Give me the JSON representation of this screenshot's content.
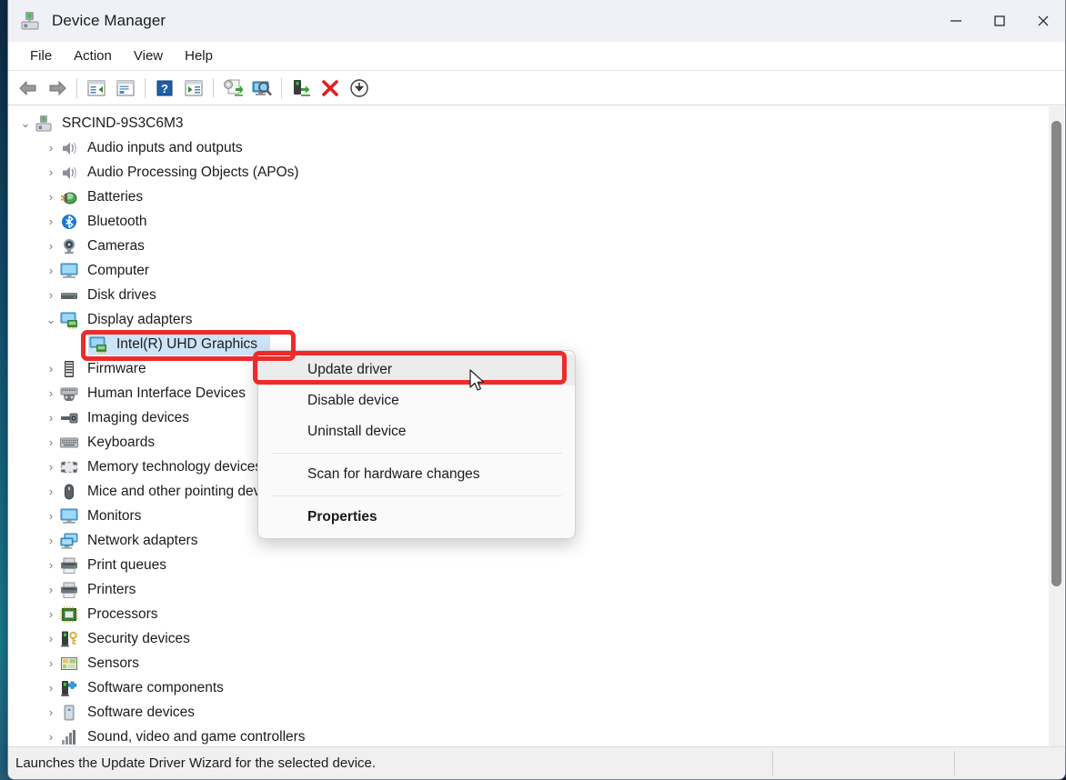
{
  "window": {
    "title": "Device Manager",
    "icon": "device-manager-icon",
    "controls": {
      "minimize": "—",
      "maximize": "☐",
      "close": "✕"
    }
  },
  "menubar": {
    "items": [
      {
        "label": "File",
        "name": "menu-file"
      },
      {
        "label": "Action",
        "name": "menu-action"
      },
      {
        "label": "View",
        "name": "menu-view"
      },
      {
        "label": "Help",
        "name": "menu-help"
      }
    ]
  },
  "toolbar": {
    "buttons": [
      {
        "name": "back-icon",
        "glyph": "back-arrow"
      },
      {
        "name": "forward-icon",
        "glyph": "forward-arrow"
      },
      {
        "name": "separator",
        "glyph": "sep"
      },
      {
        "name": "show-hide-console-tree-icon",
        "glyph": "window-tree"
      },
      {
        "name": "properties-window-icon",
        "glyph": "window-props"
      },
      {
        "name": "separator",
        "glyph": "sep"
      },
      {
        "name": "help-icon",
        "glyph": "help-question"
      },
      {
        "name": "show-hide-action-pane-icon",
        "glyph": "window-play"
      },
      {
        "name": "separator",
        "glyph": "sep"
      },
      {
        "name": "update-driver-icon",
        "glyph": "gear-update"
      },
      {
        "name": "scan-for-hardware-changes-icon",
        "glyph": "monitor-scan"
      },
      {
        "name": "separator",
        "glyph": "sep"
      },
      {
        "name": "enable-device-icon",
        "glyph": "device-enable"
      },
      {
        "name": "uninstall-device-icon",
        "glyph": "red-x"
      },
      {
        "name": "download-icon",
        "glyph": "circle-down-arrow"
      }
    ]
  },
  "tree": {
    "root": {
      "label": "SRCIND-9S3C6M3",
      "icon": "computer-device-icon",
      "expanded": true,
      "chevron": "⌄"
    },
    "items": [
      {
        "label": "Audio inputs and outputs",
        "icon": "speaker-icon",
        "level": 1,
        "expanded": false
      },
      {
        "label": "Audio Processing Objects (APOs)",
        "icon": "speaker-icon",
        "level": 1,
        "expanded": false
      },
      {
        "label": "Batteries",
        "icon": "battery-icon",
        "level": 1,
        "expanded": false
      },
      {
        "label": "Bluetooth",
        "icon": "bluetooth-icon",
        "level": 1,
        "expanded": false
      },
      {
        "label": "Cameras",
        "icon": "camera-icon",
        "level": 1,
        "expanded": false
      },
      {
        "label": "Computer",
        "icon": "monitor-icon",
        "level": 1,
        "expanded": false
      },
      {
        "label": "Disk drives",
        "icon": "disk-drive-icon",
        "level": 1,
        "expanded": false
      },
      {
        "label": "Display adapters",
        "icon": "display-adapter-icon",
        "level": 1,
        "expanded": true
      },
      {
        "label": "Intel(R) UHD Graphics",
        "icon": "display-adapter-icon",
        "level": 2,
        "selected": true
      },
      {
        "label": "Firmware",
        "icon": "firmware-icon",
        "level": 1,
        "expanded": false
      },
      {
        "label": "Human Interface Devices",
        "icon": "hid-icon",
        "level": 1,
        "expanded": false
      },
      {
        "label": "Imaging devices",
        "icon": "imaging-icon",
        "level": 1,
        "expanded": false
      },
      {
        "label": "Keyboards",
        "icon": "keyboard-icon",
        "level": 1,
        "expanded": false
      },
      {
        "label": "Memory technology devices",
        "icon": "memory-icon",
        "level": 1,
        "expanded": false
      },
      {
        "label": "Mice and other pointing devices",
        "icon": "mouse-icon",
        "level": 1,
        "expanded": false
      },
      {
        "label": "Monitors",
        "icon": "monitor-icon",
        "level": 1,
        "expanded": false
      },
      {
        "label": "Network adapters",
        "icon": "network-adapter-icon",
        "level": 1,
        "expanded": false
      },
      {
        "label": "Print queues",
        "icon": "printer-icon",
        "level": 1,
        "expanded": false
      },
      {
        "label": "Printers",
        "icon": "printer-icon",
        "level": 1,
        "expanded": false
      },
      {
        "label": "Processors",
        "icon": "processor-icon",
        "level": 1,
        "expanded": false
      },
      {
        "label": "Security devices",
        "icon": "security-device-icon",
        "level": 1,
        "expanded": false
      },
      {
        "label": "Sensors",
        "icon": "sensor-icon",
        "level": 1,
        "expanded": false
      },
      {
        "label": "Software components",
        "icon": "software-component-icon",
        "level": 1,
        "expanded": false
      },
      {
        "label": "Software devices",
        "icon": "software-device-icon",
        "level": 1,
        "expanded": false
      },
      {
        "label": "Sound, video and game controllers",
        "icon": "sound-controller-icon",
        "level": 1,
        "expanded": false
      }
    ],
    "collapsed_chevron": "›"
  },
  "context_menu": {
    "items": [
      {
        "label": "Update driver",
        "name": "context-menu-update-driver",
        "hovered": true,
        "bold": false
      },
      {
        "label": "Disable device",
        "name": "context-menu-disable-device",
        "hovered": false,
        "bold": false
      },
      {
        "label": "Uninstall device",
        "name": "context-menu-uninstall-device",
        "hovered": false,
        "bold": false
      },
      {
        "label": "Scan for hardware changes",
        "name": "context-menu-scan-hardware",
        "hovered": false,
        "bold": false
      },
      {
        "label": "Properties",
        "name": "context-menu-properties",
        "hovered": false,
        "bold": true
      }
    ]
  },
  "statusbar": {
    "text": "Launches the Update Driver Wizard for the selected device."
  },
  "annotations": {
    "highlight_color": "#ee2b2b",
    "boxes": [
      {
        "name": "annotation-selected-device",
        "target": "Intel(R) UHD Graphics"
      },
      {
        "name": "annotation-update-driver",
        "target": "Update driver"
      }
    ]
  },
  "colors": {
    "selection": "#cce4f7",
    "annotation": "#ee2b2b",
    "titlebar": "#eff1f7"
  }
}
